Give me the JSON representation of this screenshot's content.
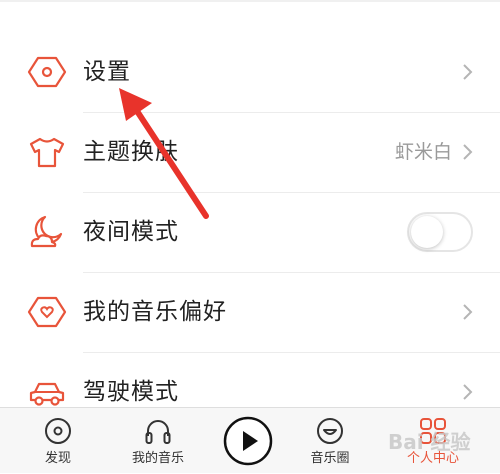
{
  "menu": {
    "items": [
      {
        "label": "设置",
        "icon": "gear-hexagon-icon",
        "chevron": true
      },
      {
        "label": "主题换肤",
        "icon": "tshirt-icon",
        "value": "虾米白",
        "chevron": true
      },
      {
        "label": "夜间模式",
        "icon": "moon-cloud-icon",
        "toggle": false
      },
      {
        "label": "我的音乐偏好",
        "icon": "heart-hexagon-icon",
        "chevron": true
      },
      {
        "label": "驾驶模式",
        "icon": "car-icon",
        "chevron": true
      }
    ]
  },
  "tab_bar": {
    "tabs": [
      {
        "label": "发现",
        "icon": "disc-icon"
      },
      {
        "label": "我的音乐",
        "icon": "headphones-icon"
      },
      {
        "label": "",
        "icon": "play-icon"
      },
      {
        "label": "音乐圈",
        "icon": "smiley-icon"
      },
      {
        "label": "个人中心",
        "icon": "grid-icon",
        "active": true
      }
    ]
  },
  "watermark": "Bai 经验",
  "colors": {
    "accent": "#e8543a",
    "arrow": "#e8332b",
    "text": "#222222",
    "secondary_text": "#9a9a9a"
  }
}
